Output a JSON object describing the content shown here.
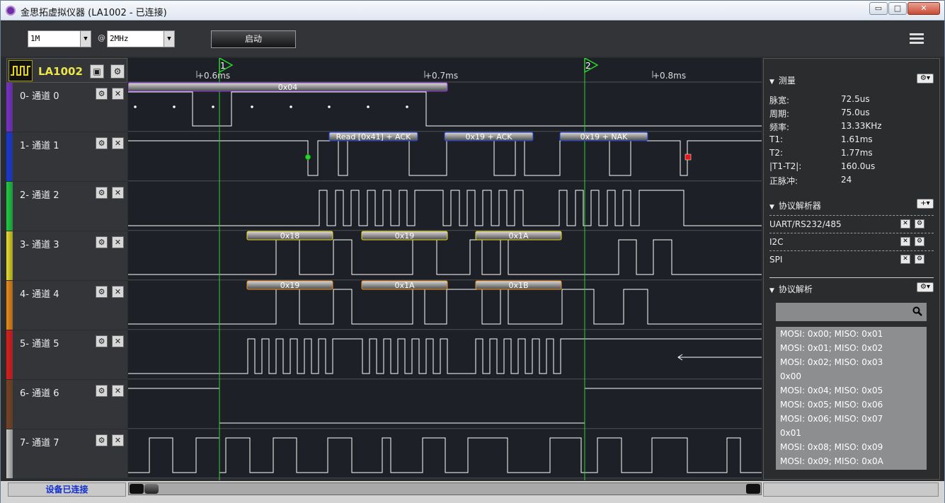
{
  "window": {
    "title": "金思拓虚拟仪器 (LA1002 - 已连接)",
    "min_label": "▭",
    "max_label": "□",
    "close_label": "✕"
  },
  "toolbar": {
    "samples_select": "1M",
    "at_label": "@",
    "rate_select": "2MHz",
    "start_label": "启动"
  },
  "device": {
    "name": "LA1002"
  },
  "ruler": {
    "ticks": [
      "+0.6ms",
      "+0.7ms",
      "+0.8ms"
    ],
    "markers": [
      "1",
      "2"
    ]
  },
  "channels": [
    {
      "label": "0-  通道 0",
      "color": "#7a2fd0"
    },
    {
      "label": "1-  通道 1",
      "color": "#1636e0"
    },
    {
      "label": "2-  通道 2",
      "color": "#18d040"
    },
    {
      "label": "3-  通道 3",
      "color": "#e8e020"
    },
    {
      "label": "4-  通道 4",
      "color": "#f08a10"
    },
    {
      "label": "5-  通道 5",
      "color": "#e81818"
    },
    {
      "label": "6-  通道 6",
      "color": "#7a4220"
    },
    {
      "label": "7-  通道 7",
      "color": "#c8c8c8"
    }
  ],
  "decode_labels": {
    "ch0": [
      "0x04"
    ],
    "ch1": [
      "Read [0x41] + ACK",
      "0x19 + ACK",
      "0x19 + NAK"
    ],
    "ch3": [
      "0x18",
      "0x19",
      "0x1A"
    ],
    "ch4": [
      "0x19",
      "0x1A",
      "0x1B"
    ]
  },
  "measure": {
    "title": "测量",
    "rows": [
      {
        "k": "脉宽:",
        "v": "72.5us"
      },
      {
        "k": "周期:",
        "v": "75.0us"
      },
      {
        "k": "频率:",
        "v": "13.33KHz"
      },
      {
        "k": "T1:",
        "v": "1.61ms"
      },
      {
        "k": "T2:",
        "v": "1.77ms"
      },
      {
        "k": "|T1-T2|:",
        "v": "160.0us"
      },
      {
        "k": "正脉冲:",
        "v": "24"
      }
    ]
  },
  "protocol_analyzers": {
    "title": "协议解析器",
    "items": [
      "UART/RS232/485",
      "I2C",
      "SPI"
    ]
  },
  "protocol_decode": {
    "title": "协议解析",
    "search_placeholder": "",
    "items": [
      "MOSI: 0x00;  MISO: 0x01",
      "MOSI: 0x01;  MISO: 0x02",
      "MOSI: 0x02;  MISO: 0x03",
      "0x00",
      "MOSI: 0x04;  MISO: 0x05",
      "MOSI: 0x05;  MISO: 0x06",
      "MOSI: 0x06;  MISO: 0x07",
      "0x01",
      "MOSI: 0x08;  MISO: 0x09",
      "MOSI: 0x09;  MISO: 0x0A"
    ]
  },
  "status": {
    "text": "设备已连接"
  },
  "colors": {
    "cursor": "#28d828",
    "accent": "#ece64a",
    "trace": "#ffffff"
  }
}
